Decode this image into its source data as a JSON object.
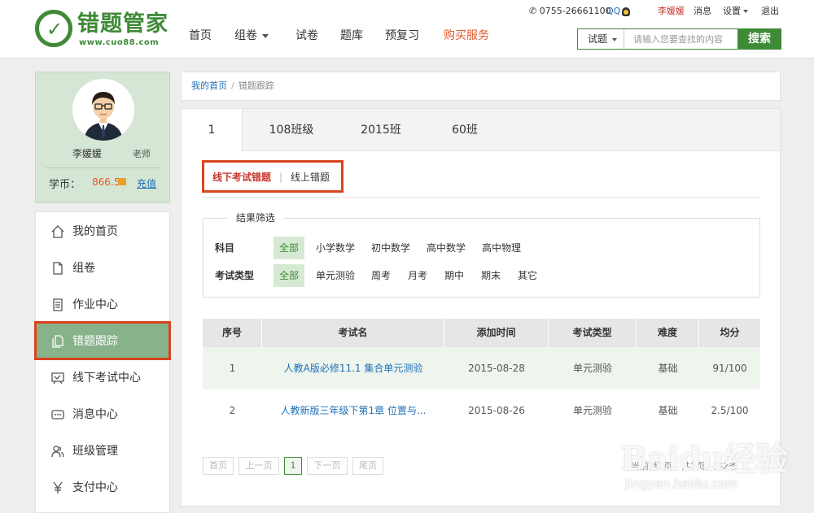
{
  "logo": {
    "name": "错题管家",
    "url": "www.cuo88.com"
  },
  "nav": [
    {
      "label": "首页"
    },
    {
      "label": "组卷"
    },
    {
      "label": "试卷"
    },
    {
      "label": "题库"
    },
    {
      "label": "预复习"
    },
    {
      "label": "购买服务"
    }
  ],
  "topbar": {
    "phone": "0755-26661100",
    "qq": "QQ",
    "user": "李媛媛",
    "messages": "消息",
    "settings": "设置",
    "logout": "退出"
  },
  "search": {
    "type": "试题",
    "placeholder": "请输入您要查找的内容",
    "button": "搜索"
  },
  "profile": {
    "name": "李媛媛",
    "role": "老师",
    "coin_label": "学币：",
    "coin_value": "866.5",
    "recharge": "充值"
  },
  "sidemenu": [
    {
      "label": "我的首页",
      "icon": "home-icon"
    },
    {
      "label": "组卷",
      "icon": "document-icon"
    },
    {
      "label": "作业中心",
      "icon": "notebook-icon"
    },
    {
      "label": "错题跟踪",
      "icon": "copy-icon"
    },
    {
      "label": "线下考试中心",
      "icon": "board-icon"
    },
    {
      "label": "消息中心",
      "icon": "chat-icon"
    },
    {
      "label": "班级管理",
      "icon": "users-icon"
    },
    {
      "label": "支付中心",
      "icon": "yen-icon"
    }
  ],
  "breadcrumb": {
    "home": "我的首页",
    "sep": "/",
    "current": "错题跟踪"
  },
  "tabs": [
    {
      "label": "1"
    },
    {
      "label": "108班级"
    },
    {
      "label": "2015班"
    },
    {
      "label": "60班"
    }
  ],
  "subtabs": {
    "offline": "线下考试错题",
    "sep": "|",
    "online": "线上错题"
  },
  "filter": {
    "legend": "结果筛选",
    "subject_label": "科目",
    "subjects": [
      "全部",
      "小学数学",
      "初中数学",
      "高中数学",
      "高中物理"
    ],
    "type_label": "考试类型",
    "types": [
      "全部",
      "单元测验",
      "周考",
      "月考",
      "期中",
      "期末",
      "其它"
    ]
  },
  "table": {
    "headers": [
      "序号",
      "考试名",
      "添加时间",
      "考试类型",
      "难度",
      "均分"
    ],
    "rows": [
      [
        "1",
        "人教A版必修11.1 集合单元测验",
        "2015-08-28",
        "单元测验",
        "基础",
        "91/100"
      ],
      [
        "2",
        "人教新版三年级下第1章 位置与...",
        "2015-08-26",
        "单元测验",
        "基础",
        "2.5/100"
      ]
    ]
  },
  "pager": {
    "first": "首页",
    "prev": "上一页",
    "current": "1",
    "next": "下一页",
    "last": "尾页",
    "info": "当前第1页，共1页，共2条"
  },
  "watermark": {
    "text": "Baidu经验",
    "url": "jingyan.baidu.com"
  },
  "colors": {
    "brand": "#3f8a37",
    "highlight": "#d9431e",
    "active_menu": "#87b28a",
    "accent": "#e05a2b"
  }
}
